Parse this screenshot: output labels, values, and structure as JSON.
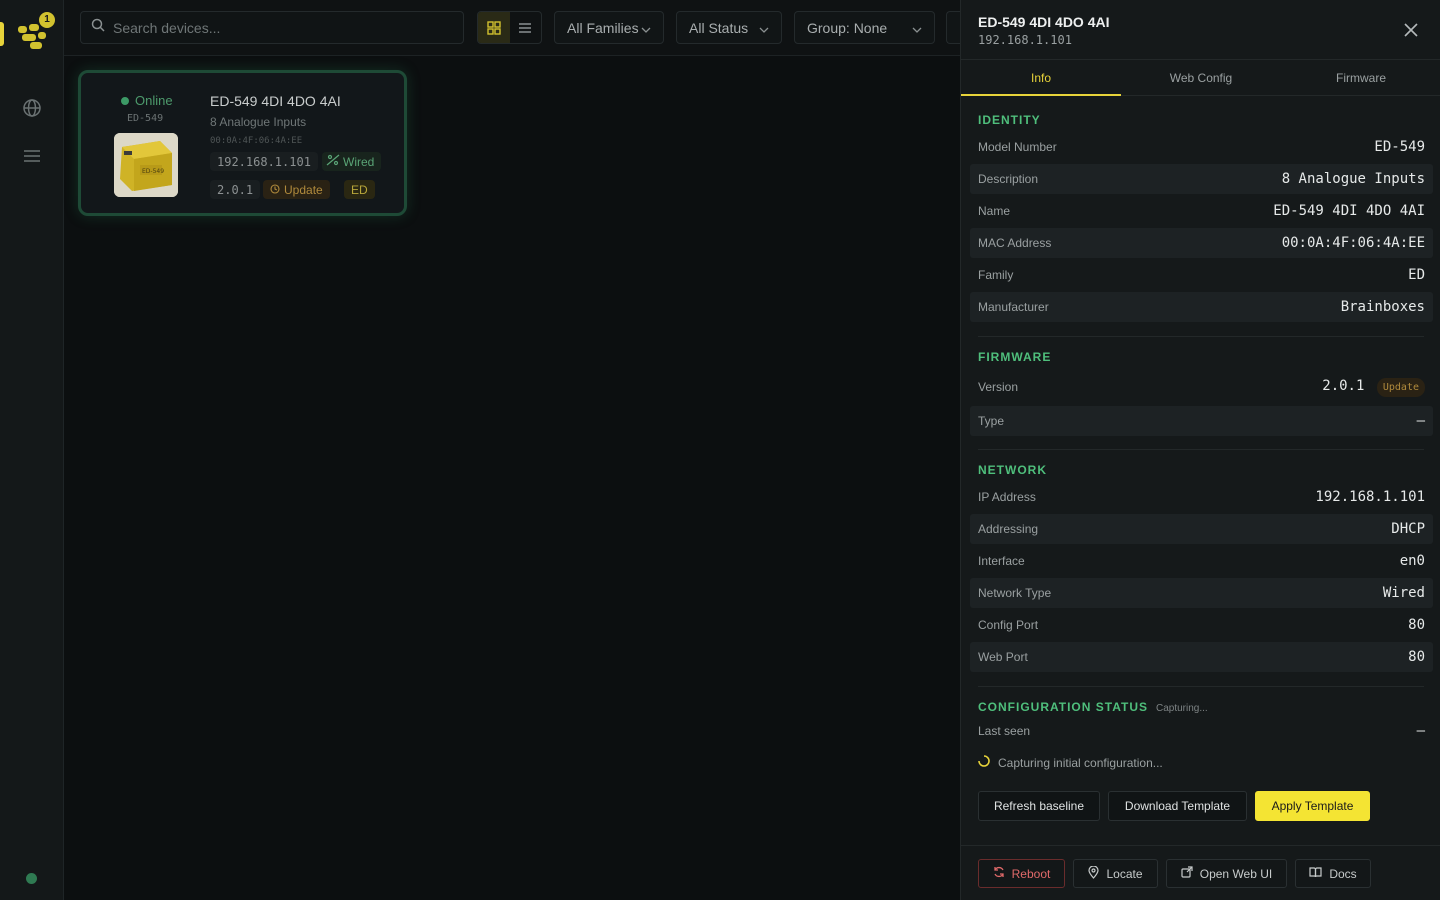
{
  "app": {
    "notification_count": "1",
    "colors": {
      "accent": "#f4e433",
      "online": "#3c9a66",
      "section": "#4fbf7c",
      "danger": "#e06a6a"
    }
  },
  "toolbar": {
    "search_placeholder": "Search devices...",
    "family_filter": "All Families",
    "status_filter": "All Status",
    "group_filter": "Group: None"
  },
  "card": {
    "status": "Online",
    "model": "ED-549",
    "name": "ED-549 4DI 4DO 4AI",
    "description": "8 Analogue Inputs",
    "mac": "00:0A:4F:06:4A:EE",
    "ip": "192.168.1.101",
    "network": "Wired",
    "version": "2.0.1",
    "update": "Update",
    "family": "ED",
    "image_label": "ED-549"
  },
  "panel": {
    "title": "ED-549 4DI 4DO 4AI",
    "subtitle": "192.168.1.101",
    "tabs": [
      "Info",
      "Web Config",
      "Firmware"
    ],
    "identity": {
      "title": "IDENTITY",
      "rows": [
        {
          "k": "Model Number",
          "v": "ED-549"
        },
        {
          "k": "Description",
          "v": "8 Analogue Inputs"
        },
        {
          "k": "Name",
          "v": "ED-549 4DI 4DO 4AI"
        },
        {
          "k": "MAC Address",
          "v": "00:0A:4F:06:4A:EE"
        },
        {
          "k": "Family",
          "v": "ED"
        },
        {
          "k": "Manufacturer",
          "v": "Brainboxes"
        }
      ]
    },
    "firmware": {
      "title": "FIRMWARE",
      "version_label": "Version",
      "version_value": "2.0.1",
      "update_badge": "Update",
      "type_label": "Type",
      "type_value": "—"
    },
    "network": {
      "title": "NETWORK",
      "rows": [
        {
          "k": "IP Address",
          "v": "192.168.1.101"
        },
        {
          "k": "Addressing",
          "v": "DHCP"
        },
        {
          "k": "Interface",
          "v": "en0"
        },
        {
          "k": "Network Type",
          "v": "Wired"
        },
        {
          "k": "Config Port",
          "v": "80"
        },
        {
          "k": "Web Port",
          "v": "80"
        }
      ]
    },
    "config": {
      "title": "CONFIGURATION STATUS",
      "tag": "Capturing...",
      "last_seen_label": "Last seen",
      "last_seen_value": "—",
      "capturing_text": "Capturing initial configuration...",
      "refresh": "Refresh baseline",
      "download": "Download Template",
      "apply": "Apply Template"
    },
    "footer": {
      "reboot": "Reboot",
      "locate": "Locate",
      "web_ui": "Open Web UI",
      "docs": "Docs"
    }
  }
}
